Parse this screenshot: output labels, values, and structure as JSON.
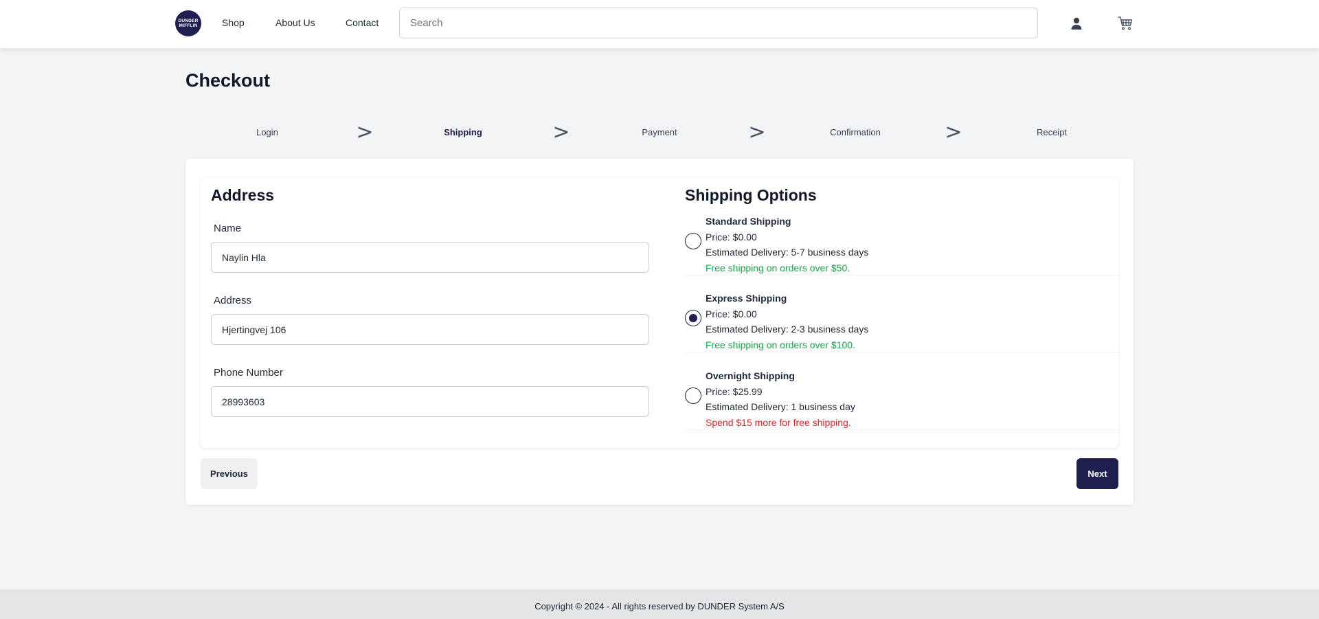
{
  "nav": {
    "logo_line1": "DUNDER",
    "logo_line2": "MIFFLIN",
    "links": [
      "Shop",
      "About Us",
      "Contact"
    ],
    "search_placeholder": "Search",
    "icons": [
      "user-icon",
      "cart-icon"
    ]
  },
  "page": {
    "title": "Checkout"
  },
  "steps": {
    "items": [
      "Login",
      "Shipping",
      "Payment",
      "Confirmation",
      "Receipt"
    ],
    "active": "Shipping",
    "separator": ">"
  },
  "address": {
    "title": "Address",
    "fields": [
      {
        "label": "Name",
        "value": "Naylin Hla"
      },
      {
        "label": "Address",
        "value": "Hjertingvej 106"
      },
      {
        "label": "Phone Number",
        "value": "28993603"
      }
    ]
  },
  "shipping": {
    "title": "Shipping Options",
    "options": [
      {
        "name": "Standard Shipping",
        "price": "Price: $0.00",
        "delivery": "Estimated Delivery: 5-7 business days",
        "note": "Free shipping on orders over $50.",
        "note_color": "#16a34a",
        "selected": false
      },
      {
        "name": "Express Shipping",
        "price": "Price: $0.00",
        "delivery": "Estimated Delivery: 2-3 business days",
        "note": "Free shipping on orders over $100.",
        "note_color": "#16a34a",
        "selected": true
      },
      {
        "name": "Overnight Shipping",
        "price": "Price: $25.99",
        "delivery": "Estimated Delivery: 1 business day",
        "note": "Spend $15 more for free shipping.",
        "note_color": "#dc2626",
        "selected": false
      }
    ]
  },
  "buttons": {
    "previous": "Previous",
    "next": "Next"
  },
  "footer": {
    "text": "Copyright © 2024 - All rights reserved by DUNDER System A/S"
  },
  "colors": {
    "brand": "#1e1f4e",
    "success": "#16a34a",
    "danger": "#dc2626"
  }
}
